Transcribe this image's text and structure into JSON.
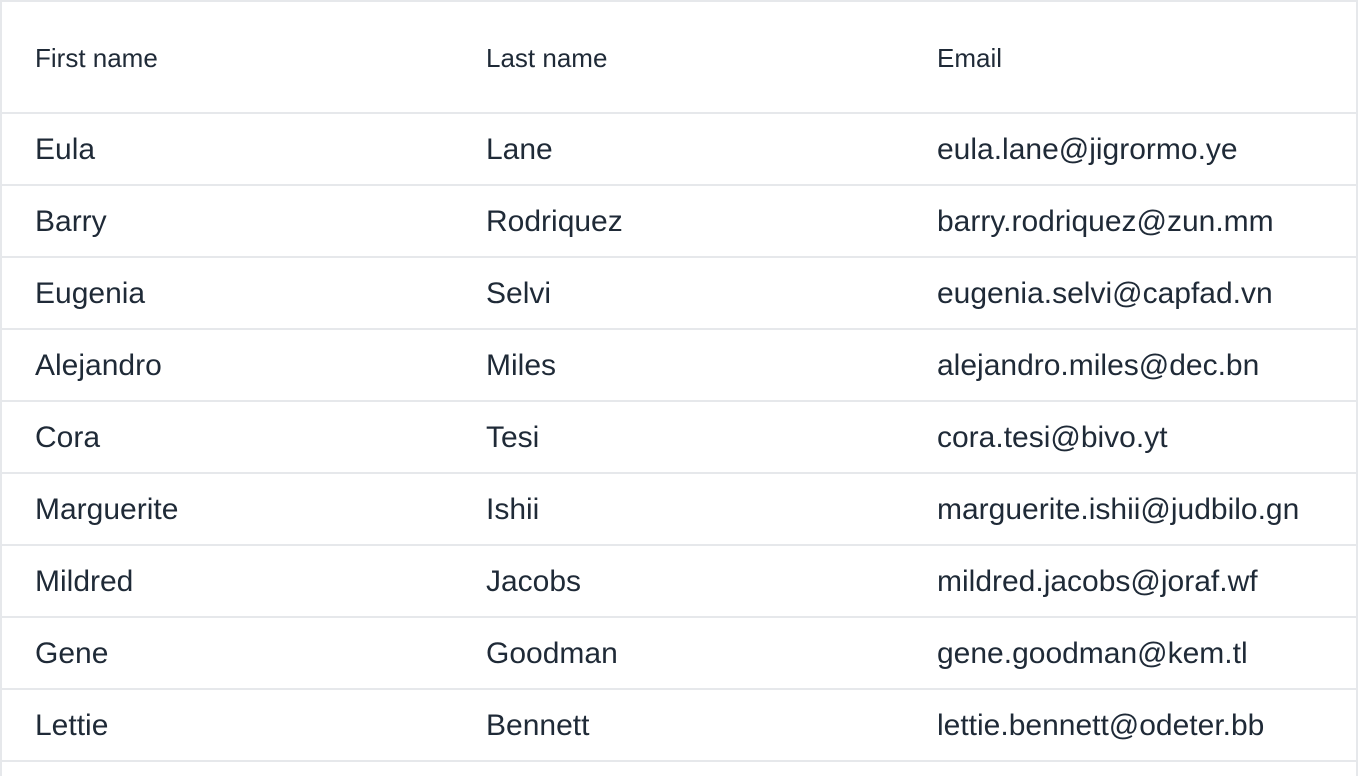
{
  "grid": {
    "columns": [
      {
        "key": "first",
        "label": "First name"
      },
      {
        "key": "last",
        "label": "Last name"
      },
      {
        "key": "email",
        "label": "Email"
      }
    ],
    "rows": [
      {
        "first": "Eula",
        "last": "Lane",
        "email": "eula.lane@jigrormo.ye"
      },
      {
        "first": "Barry",
        "last": "Rodriquez",
        "email": "barry.rodriquez@zun.mm"
      },
      {
        "first": "Eugenia",
        "last": "Selvi",
        "email": "eugenia.selvi@capfad.vn"
      },
      {
        "first": "Alejandro",
        "last": "Miles",
        "email": "alejandro.miles@dec.bn"
      },
      {
        "first": "Cora",
        "last": "Tesi",
        "email": "cora.tesi@bivo.yt"
      },
      {
        "first": "Marguerite",
        "last": "Ishii",
        "email": "marguerite.ishii@judbilo.gn"
      },
      {
        "first": "Mildred",
        "last": "Jacobs",
        "email": "mildred.jacobs@joraf.wf"
      },
      {
        "first": "Gene",
        "last": "Goodman",
        "email": "gene.goodman@kem.tl"
      },
      {
        "first": "Lettie",
        "last": "Bennett",
        "email": "lettie.bennett@odeter.bb"
      }
    ]
  },
  "colors": {
    "text": "#1f2a37",
    "border": "#e6e8eb",
    "background": "#ffffff"
  }
}
